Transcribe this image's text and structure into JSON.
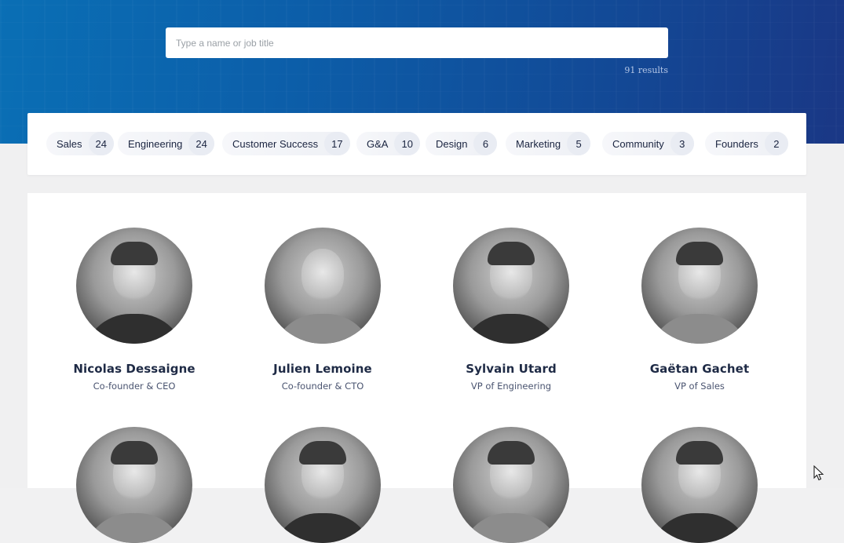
{
  "search": {
    "placeholder": "Type a name or job title",
    "results_text": "91 results"
  },
  "filters": [
    {
      "label": "Sales",
      "count": "24"
    },
    {
      "label": "Engineering",
      "count": "24"
    },
    {
      "label": "Customer Success",
      "count": "17"
    },
    {
      "label": "G&A",
      "count": "10"
    },
    {
      "label": "Design",
      "count": "6"
    },
    {
      "label": "Marketing",
      "count": "5"
    },
    {
      "label": "Community",
      "count": "3"
    },
    {
      "label": "Founders",
      "count": "2"
    }
  ],
  "people": [
    {
      "name": "Nicolas Dessaigne",
      "role": "Co-founder & CEO"
    },
    {
      "name": "Julien Lemoine",
      "role": "Co-founder & CTO"
    },
    {
      "name": "Sylvain Utard",
      "role": "VP of Engineering"
    },
    {
      "name": "Gaëtan Gachet",
      "role": "VP of Sales"
    }
  ],
  "colors": {
    "hero_start": "#0a6fb5",
    "hero_end": "#1a3785",
    "text_dark": "#1e2a45",
    "chip_count_bg": "#e9ecf3"
  }
}
